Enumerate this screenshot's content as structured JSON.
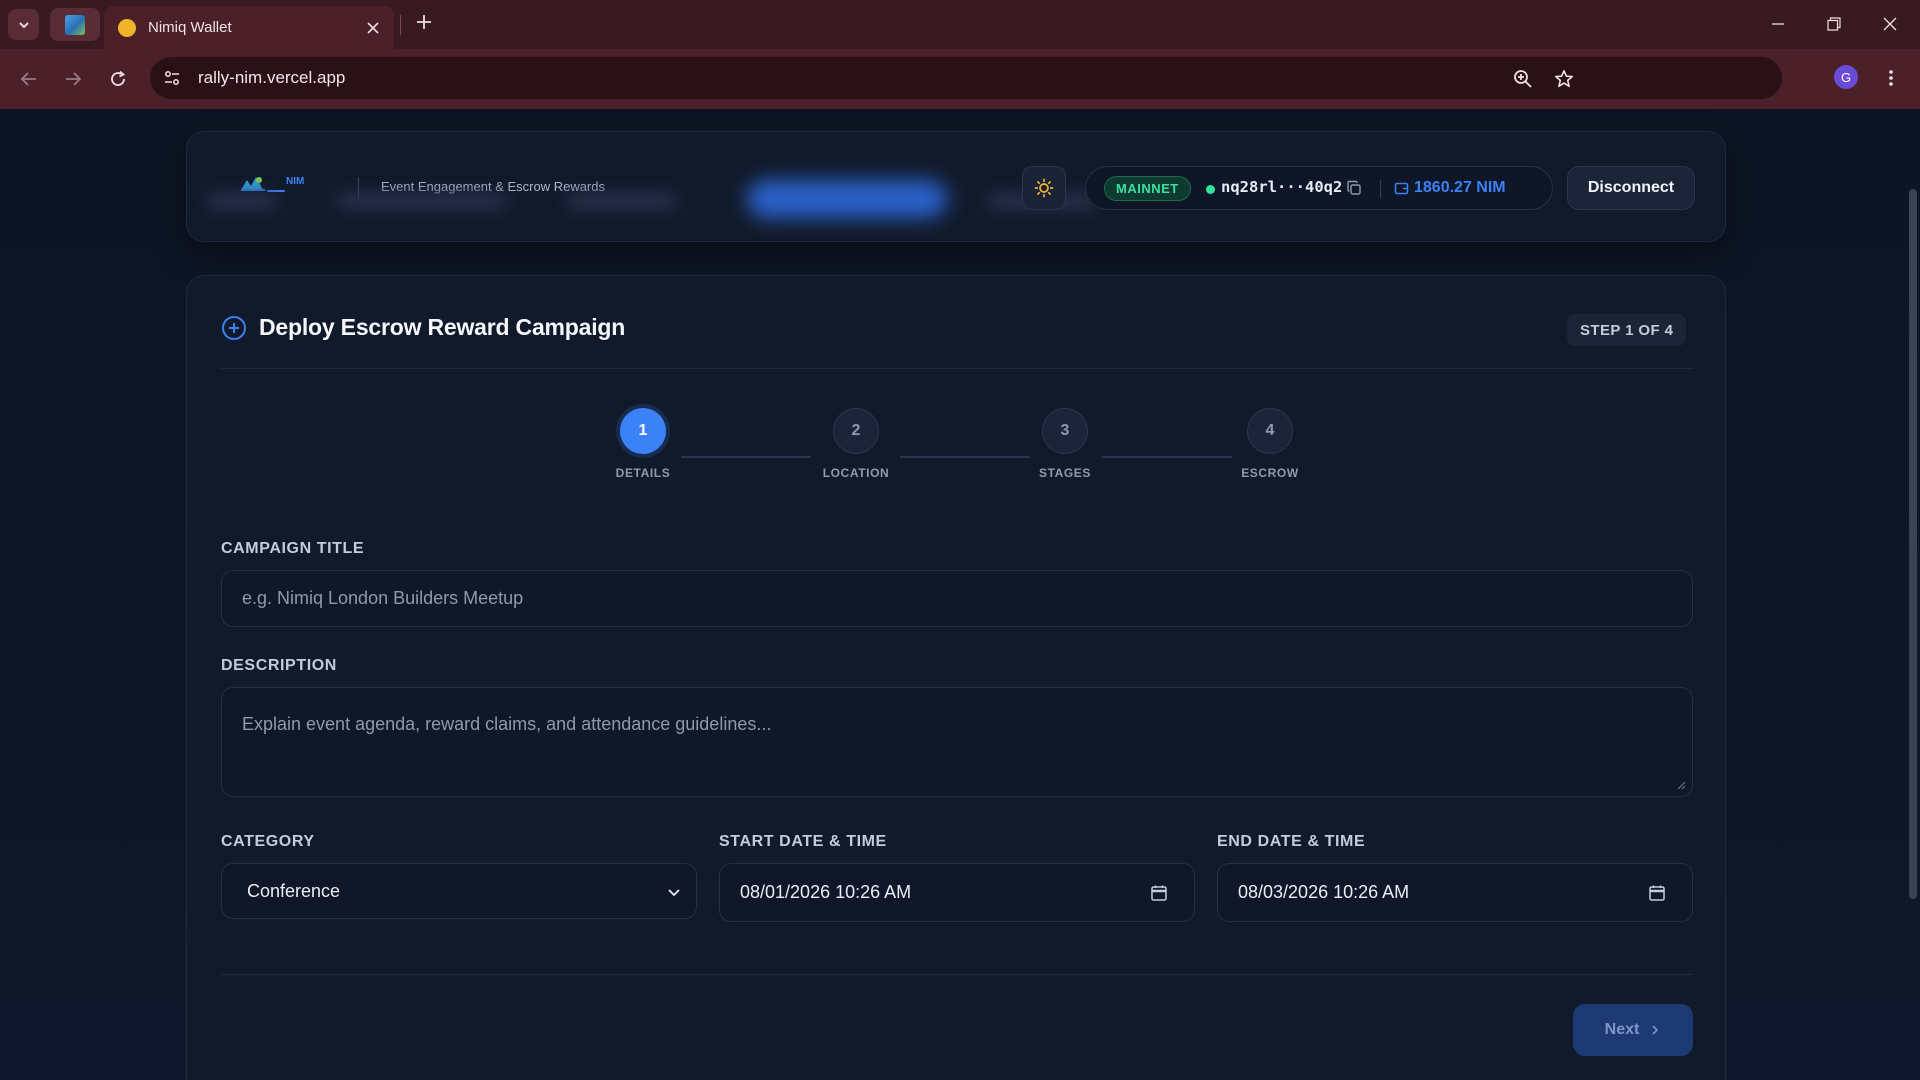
{
  "browser": {
    "tab_title": "Nimiq Wallet",
    "url": "rally-nim.vercel.app",
    "profile_initial": "G"
  },
  "header": {
    "logo_text": "NIM",
    "tagline": "Event Engagement & Escrow Rewards",
    "network": "MAINNET",
    "address": "nq28rl···40q2",
    "balance": "1860.27 NIM",
    "disconnect_label": "Disconnect"
  },
  "form": {
    "title": "Deploy Escrow Reward Campaign",
    "step_indicator": "STEP 1 OF 4",
    "steps": [
      {
        "number": "1",
        "label": "DETAILS"
      },
      {
        "number": "2",
        "label": "LOCATION"
      },
      {
        "number": "3",
        "label": "STAGES"
      },
      {
        "number": "4",
        "label": "ESCROW"
      }
    ],
    "campaign_title_label": "CAMPAIGN TITLE",
    "campaign_title_placeholder": "e.g. Nimiq London Builders Meetup",
    "description_label": "DESCRIPTION",
    "description_placeholder": "Explain event agenda, reward claims, and attendance guidelines...",
    "category_label": "CATEGORY",
    "category_value": "Conference",
    "start_label": "START DATE & TIME",
    "start_value": "08/01/2026 10:26 AM",
    "end_label": "END DATE & TIME",
    "end_value": "08/03/2026 10:26 AM",
    "next_label": "Next"
  },
  "colors": {
    "accent": "#3b82f6",
    "mainnet_green": "#3de0a2",
    "background": "#0f172a"
  },
  "icons": [
    "tab-search-icon",
    "close-icon",
    "plus-icon",
    "minimize-icon",
    "restore-icon",
    "back-icon",
    "forward-icon",
    "reload-icon",
    "site-info-icon",
    "zoom-icon",
    "star-icon",
    "more-icon",
    "sun-icon",
    "copy-icon",
    "wallet-icon",
    "plus-circle-icon",
    "chevron-down-icon",
    "calendar-icon",
    "chevron-right-icon"
  ]
}
